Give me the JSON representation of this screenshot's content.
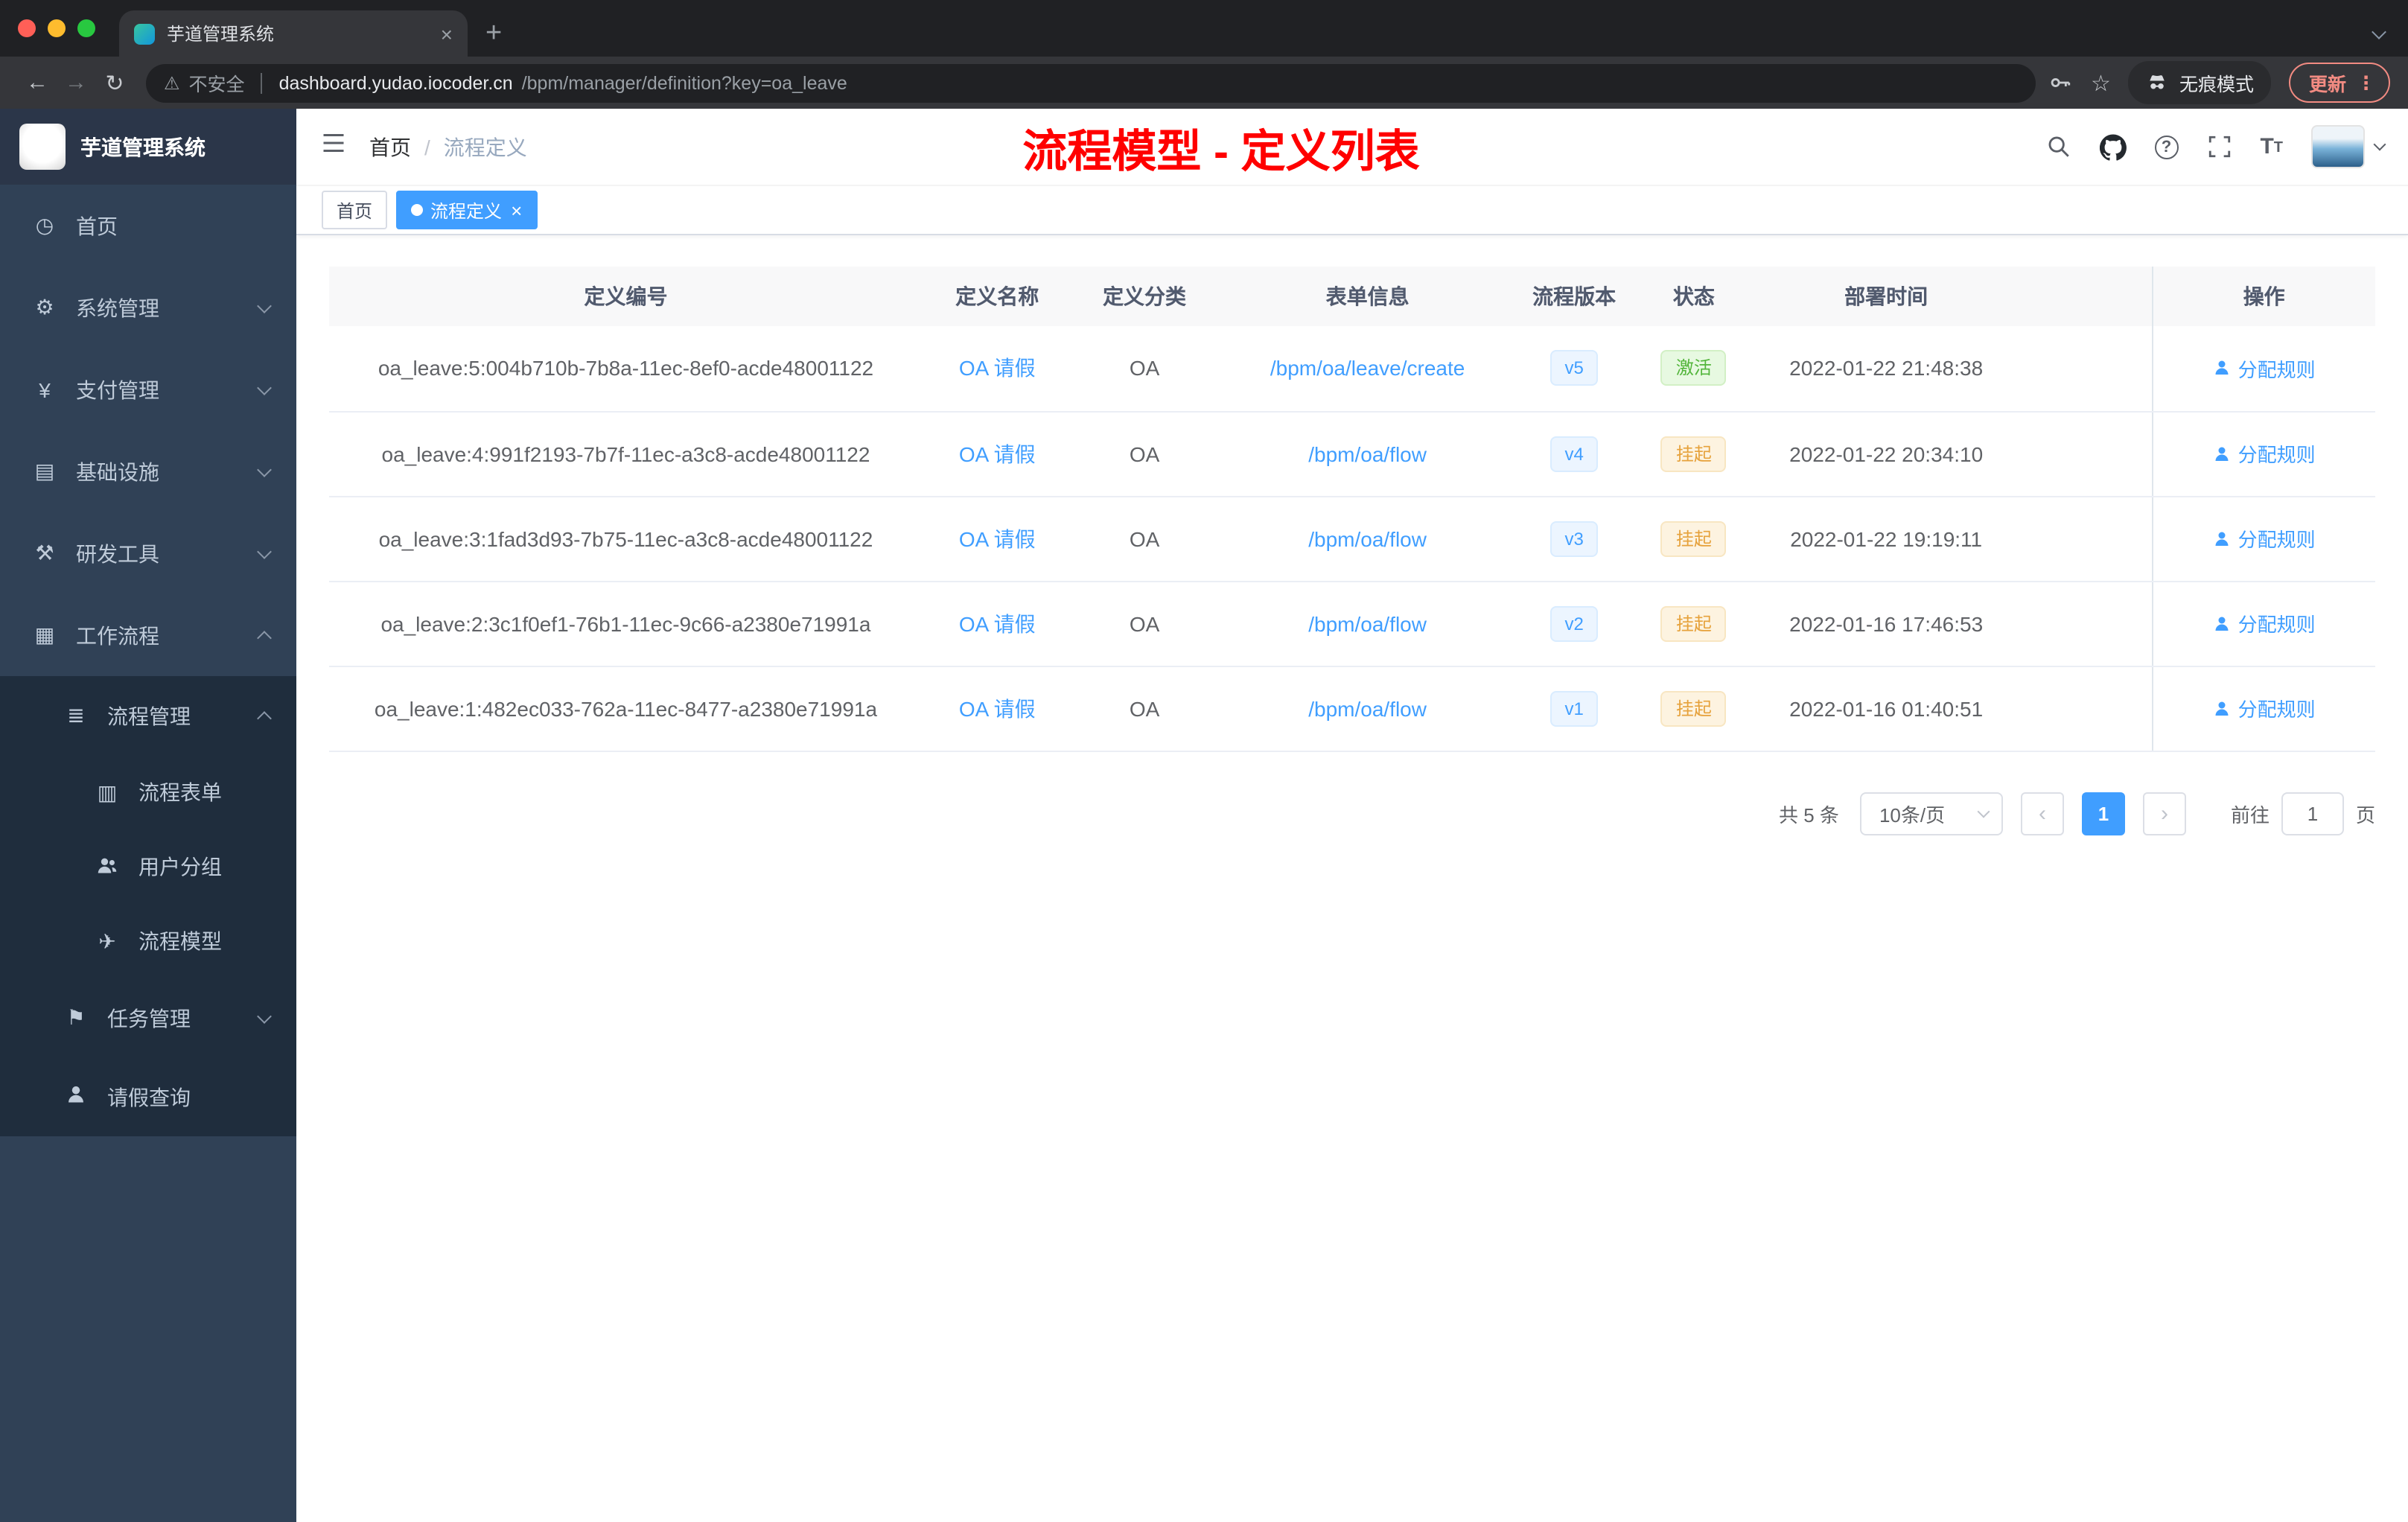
{
  "browser": {
    "tab_title": "芋道管理系统",
    "security_label": "不安全",
    "url_host": "dashboard.yudao.iocoder.cn",
    "url_path": "/bpm/manager/definition?key=oa_leave",
    "incognito_label": "无痕模式",
    "update_label": "更新"
  },
  "icons": {
    "dashboard": "◷",
    "gear": "⚙",
    "yen": "¥",
    "monitor": "▤",
    "hammer": "⚒",
    "grid": "▦",
    "list": "≣",
    "document": "▥",
    "plane": "✈",
    "flag": "⚑",
    "star": "☆",
    "warning": "⚠",
    "reload": "↻",
    "back": "←",
    "forward": "→",
    "more": "⋮",
    "close": "×",
    "plus": "+",
    "question": "?",
    "letter_t": "T",
    "prev": "‹",
    "next": "›"
  },
  "sidebar": {
    "logo_title": "芋道管理系统",
    "items": [
      {
        "label": "首页",
        "expandable": false
      },
      {
        "label": "系统管理",
        "expandable": true,
        "expanded": false
      },
      {
        "label": "支付管理",
        "expandable": true,
        "expanded": false
      },
      {
        "label": "基础设施",
        "expandable": true,
        "expanded": false
      },
      {
        "label": "研发工具",
        "expandable": true,
        "expanded": false
      },
      {
        "label": "工作流程",
        "expandable": true,
        "expanded": true
      }
    ],
    "submenu": {
      "process_manage": {
        "label": "流程管理",
        "expanded": true
      },
      "children": [
        {
          "label": "流程表单"
        },
        {
          "label": "用户分组"
        },
        {
          "label": "流程模型"
        }
      ],
      "task_manage": {
        "label": "任务管理",
        "expanded": false
      },
      "leave_query": {
        "label": "请假查询"
      }
    }
  },
  "header": {
    "breadcrumb": {
      "home": "首页",
      "separator": "/",
      "current": "流程定义"
    },
    "annotation": "流程模型 - 定义列表"
  },
  "tags": [
    {
      "label": "首页",
      "active": false
    },
    {
      "label": "流程定义",
      "active": true
    }
  ],
  "table": {
    "headers": [
      "定义编号",
      "定义名称",
      "定义分类",
      "表单信息",
      "流程版本",
      "状态",
      "部署时间",
      "操作"
    ],
    "rows": [
      {
        "id": "oa_leave:5:004b710b-7b8a-11ec-8ef0-acde48001122",
        "name": "OA 请假",
        "category": "OA",
        "form": "/bpm/oa/leave/create",
        "version": "v5",
        "status": "激活",
        "status_type": "success",
        "deploy_time": "2022-01-22 21:48:38",
        "action": "分配规则"
      },
      {
        "id": "oa_leave:4:991f2193-7b7f-11ec-a3c8-acde48001122",
        "name": "OA 请假",
        "category": "OA",
        "form": "/bpm/oa/flow",
        "version": "v4",
        "status": "挂起",
        "status_type": "warning",
        "deploy_time": "2022-01-22 20:34:10",
        "action": "分配规则"
      },
      {
        "id": "oa_leave:3:1fad3d93-7b75-11ec-a3c8-acde48001122",
        "name": "OA 请假",
        "category": "OA",
        "form": "/bpm/oa/flow",
        "version": "v3",
        "status": "挂起",
        "status_type": "warning",
        "deploy_time": "2022-01-22 19:19:11",
        "action": "分配规则"
      },
      {
        "id": "oa_leave:2:3c1f0ef1-76b1-11ec-9c66-a2380e71991a",
        "name": "OA 请假",
        "category": "OA",
        "form": "/bpm/oa/flow",
        "version": "v2",
        "status": "挂起",
        "status_type": "warning",
        "deploy_time": "2022-01-16 17:46:53",
        "action": "分配规则"
      },
      {
        "id": "oa_leave:1:482ec033-762a-11ec-8477-a2380e71991a",
        "name": "OA 请假",
        "category": "OA",
        "form": "/bpm/oa/flow",
        "version": "v1",
        "status": "挂起",
        "status_type": "warning",
        "deploy_time": "2022-01-16 01:40:51",
        "action": "分配规则"
      }
    ]
  },
  "pagination": {
    "total": "共 5 条",
    "page_size": "10条/页",
    "current_page": "1",
    "goto_label": "前往",
    "goto_value": "1",
    "page_unit": "页"
  },
  "colors": {
    "accent": "#409eff",
    "success": "#67c23a",
    "warning": "#e6a23c",
    "annotation": "#ff0000",
    "sidebar_bg": "#304156",
    "submenu_bg": "#1f2d3d"
  }
}
